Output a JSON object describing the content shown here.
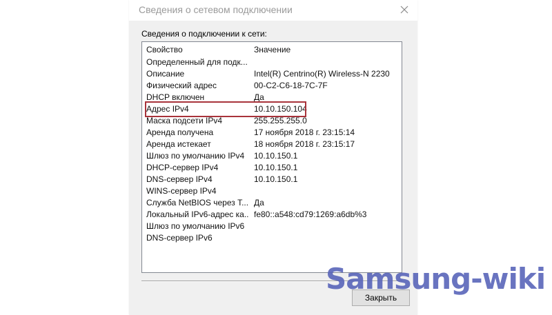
{
  "window": {
    "title": "Сведения о сетевом подключении"
  },
  "section_label": "Сведения о подключении к сети:",
  "list": {
    "columns": {
      "property": "Свойство",
      "value": "Значение"
    },
    "rows": [
      {
        "property": "Определенный для подк...",
        "value": ""
      },
      {
        "property": "Описание",
        "value": "Intel(R) Centrino(R) Wireless-N 2230"
      },
      {
        "property": "Физический адрес",
        "value": "00-C2-C6-18-7C-7F"
      },
      {
        "property": "DHCP включен",
        "value": "Да"
      },
      {
        "property": "Адрес IPv4",
        "value": "10.10.150.104"
      },
      {
        "property": "Маска подсети IPv4",
        "value": "255.255.255.0"
      },
      {
        "property": "Аренда получена",
        "value": "17 ноября 2018 г. 23:15:14"
      },
      {
        "property": "Аренда истекает",
        "value": "18 ноября 2018 г. 23:15:17"
      },
      {
        "property": "Шлюз по умолчанию IPv4",
        "value": "10.10.150.1"
      },
      {
        "property": "DHCP-сервер IPv4",
        "value": "10.10.150.1"
      },
      {
        "property": "DNS-сервер IPv4",
        "value": "10.10.150.1"
      },
      {
        "property": "WINS-сервер IPv4",
        "value": ""
      },
      {
        "property": "Служба NetBIOS через Т...",
        "value": "Да"
      },
      {
        "property": "Локальный IPv6-адрес ка...",
        "value": "fe80::a548:cd79:1269:a6db%3"
      },
      {
        "property": "Шлюз по умолчанию IPv6",
        "value": ""
      },
      {
        "property": "DNS-сервер IPv6",
        "value": ""
      }
    ]
  },
  "buttons": {
    "close_label": "Закрыть"
  },
  "watermark": "Samsung-wiki",
  "colors": {
    "highlight_border": "#a8323a",
    "watermark": "#5561b8",
    "dialog_background": "#f0f0f0"
  },
  "icons": {
    "close": "close-icon"
  }
}
